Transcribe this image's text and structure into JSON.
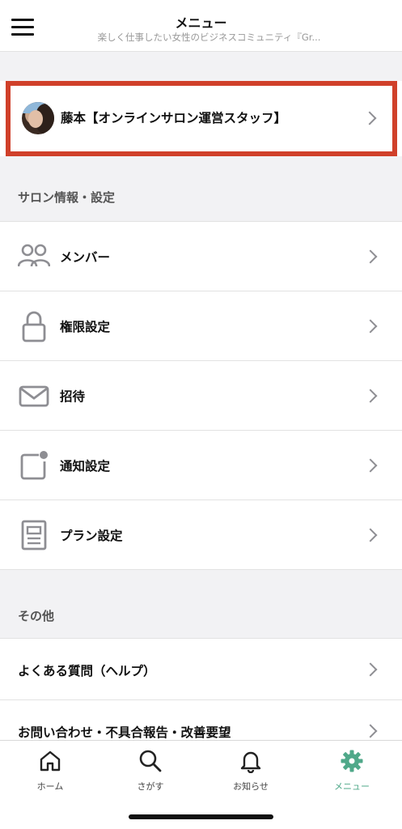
{
  "header": {
    "title": "メニュー",
    "subtitle": "楽しく仕事したい女性のビジネスコミュニティ『Gr..."
  },
  "profile": {
    "name": "藤本【オンラインサロン運営スタッフ】"
  },
  "sections": {
    "salon": {
      "title": "サロン情報・設定",
      "items": [
        {
          "label": "メンバー",
          "icon": "members-icon"
        },
        {
          "label": "権限設定",
          "icon": "lock-icon"
        },
        {
          "label": "招待",
          "icon": "mail-icon"
        },
        {
          "label": "通知設定",
          "icon": "notification-icon"
        },
        {
          "label": "プラン設定",
          "icon": "document-icon"
        }
      ]
    },
    "other": {
      "title": "その他",
      "items": [
        {
          "label": "よくある質問（ヘルプ）"
        },
        {
          "label": "お問い合わせ・不具合報告・改善要望"
        }
      ]
    }
  },
  "tabbar": {
    "tabs": [
      {
        "label": "ホーム",
        "icon": "home-icon"
      },
      {
        "label": "さがす",
        "icon": "search-icon"
      },
      {
        "label": "お知らせ",
        "icon": "bell-icon"
      },
      {
        "label": "メニュー",
        "icon": "gear-icon",
        "active": true
      }
    ],
    "active_color": "#4fa889"
  },
  "colors": {
    "highlight_border": "#d0402a",
    "section_bg": "#f2f2f4",
    "icon_gray": "#8e8e93"
  }
}
